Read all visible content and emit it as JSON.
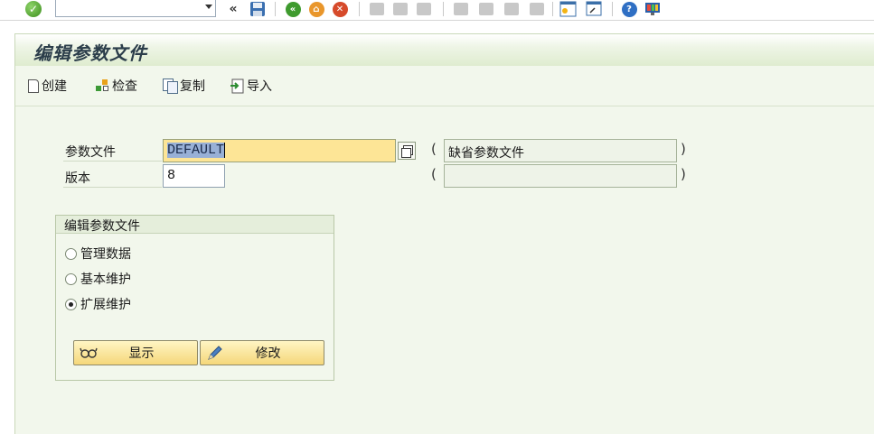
{
  "system_toolbar": {
    "command_field_value": "",
    "back_arrows": "«",
    "icons": [
      "enter-icon",
      "save-icon",
      "back-icon",
      "exit-icon",
      "cancel-icon",
      "print-icon",
      "find-icon",
      "find-next-icon",
      "first-page-icon",
      "prev-page-icon",
      "next-page-icon",
      "last-page-icon",
      "new-session-icon",
      "shortcut-icon",
      "help-icon",
      "layout-icon"
    ]
  },
  "title": "编辑参数文件",
  "app_toolbar": {
    "create_label": "创建",
    "check_label": "检查",
    "copy_label": "复制",
    "import_label": "导入"
  },
  "form": {
    "profile_label": "参数文件",
    "profile_value": "DEFAULT",
    "profile_description": "缺省参数文件",
    "version_label": "版本",
    "version_value": "8",
    "version_description": "",
    "paren_open": "(",
    "paren_close": ")"
  },
  "edit_group": {
    "title": "编辑参数文件",
    "options": [
      {
        "label": "管理数据",
        "checked": false
      },
      {
        "label": "基本维护",
        "checked": false
      },
      {
        "label": "扩展维护",
        "checked": true
      }
    ],
    "display_label": "显示",
    "change_label": "修改"
  },
  "colors": {
    "title_bar_bg": "#dfeccf",
    "content_bg": "#f2f7ec",
    "focused_field_bg": "#fde596",
    "button_bg": "#f5d77a"
  }
}
